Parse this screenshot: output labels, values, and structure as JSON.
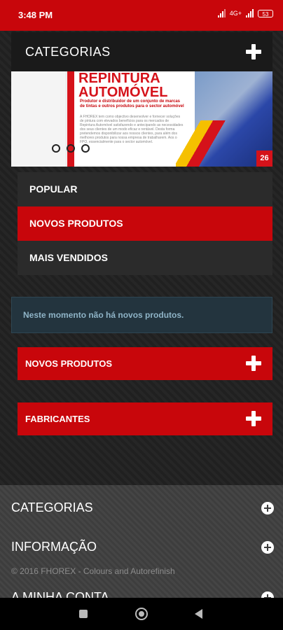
{
  "status_bar": {
    "time": "3:48 PM",
    "network": "4G+",
    "battery": "53"
  },
  "categories_header": {
    "title": "CATEGORIAS"
  },
  "banner": {
    "title_line1": "REPINTURA",
    "title_line2": "AUTOMÓVEL",
    "subtitle": "Produtor e distribuidor de um conjunto de marcas de tintas e outros produtos para o sector automóvel",
    "body": "A FHOREX tem como objectivo desenvolver e fornecer soluções de pintura com elevados benefícios para os mercados de Repintura Automóvel satisfazendo e antecipando as necessidades dos seus clientes de um modo eficaz e rentável. Desta forma pretendemos disponibilizar aos nossos clientes, para além dos melhores produtos para nossa empresa de trabalharem. Aos o FPO, essencialmente para o sector automóvel.",
    "badge": "26",
    "slide_count": 3
  },
  "tabs": [
    {
      "label": "POPULAR",
      "active": false
    },
    {
      "label": "NOVOS PRODUTOS",
      "active": true
    },
    {
      "label": "MAIS VENDIDOS",
      "active": false
    }
  ],
  "notice": {
    "text": "Neste momento não há novos produtos."
  },
  "panels": [
    {
      "label": "NOVOS PRODUTOS"
    },
    {
      "label": "FABRICANTES"
    }
  ],
  "footer": {
    "items": [
      {
        "label": "CATEGORIAS"
      },
      {
        "label": "INFORMAÇÃO"
      },
      {
        "label": "A MINHA CONTA"
      }
    ],
    "copyright": "© 2016 FHOREX - Colours and Autorefinish"
  },
  "colors": {
    "brand_red": "#c8060b",
    "notice_bg": "#23343e",
    "notice_text": "#8fb4c7"
  }
}
